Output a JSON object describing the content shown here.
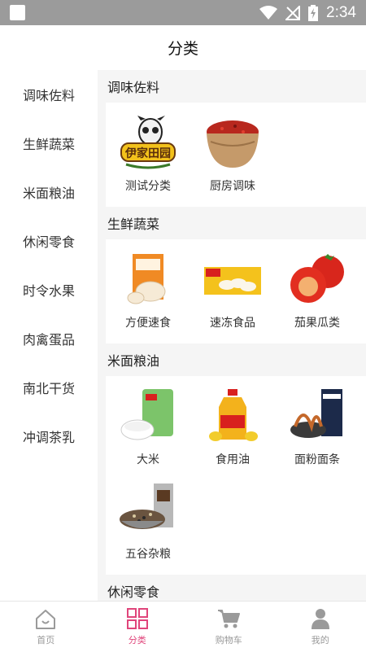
{
  "status_bar": {
    "time": "2:34"
  },
  "header": {
    "title": "分类"
  },
  "sidebar": {
    "items": [
      {
        "label": "调味佐料"
      },
      {
        "label": "生鲜蔬菜"
      },
      {
        "label": "米面粮油"
      },
      {
        "label": "休闲零食"
      },
      {
        "label": "时令水果"
      },
      {
        "label": "肉禽蛋品"
      },
      {
        "label": "南北干货"
      },
      {
        "label": "冲调茶乳"
      }
    ]
  },
  "sections": [
    {
      "title": "调味佐料",
      "items": [
        {
          "label": "测试分类",
          "icon": "brand-logo-image"
        },
        {
          "label": "厨房调味",
          "icon": "spice-bowl-image"
        }
      ]
    },
    {
      "title": "生鲜蔬菜",
      "items": [
        {
          "label": "方便速食",
          "icon": "bun-package-image"
        },
        {
          "label": "速冻食品",
          "icon": "dumpling-package-image"
        },
        {
          "label": "茄果瓜类",
          "icon": "tomato-image"
        }
      ]
    },
    {
      "title": "米面粮油",
      "items": [
        {
          "label": "大米",
          "icon": "rice-bag-image"
        },
        {
          "label": "食用油",
          "icon": "oil-bottle-image"
        },
        {
          "label": "面粉面条",
          "icon": "noodle-package-image"
        },
        {
          "label": "五谷杂粮",
          "icon": "grain-bowl-image"
        }
      ]
    },
    {
      "title": "休闲零食",
      "items": []
    }
  ],
  "tabbar": {
    "tabs": [
      {
        "label": "首页",
        "icon": "home-icon"
      },
      {
        "label": "分类",
        "icon": "category-grid-icon"
      },
      {
        "label": "购物车",
        "icon": "cart-icon"
      },
      {
        "label": "我的",
        "icon": "user-icon"
      }
    ],
    "active_color": "#e0457b",
    "inactive_color": "#999999"
  }
}
